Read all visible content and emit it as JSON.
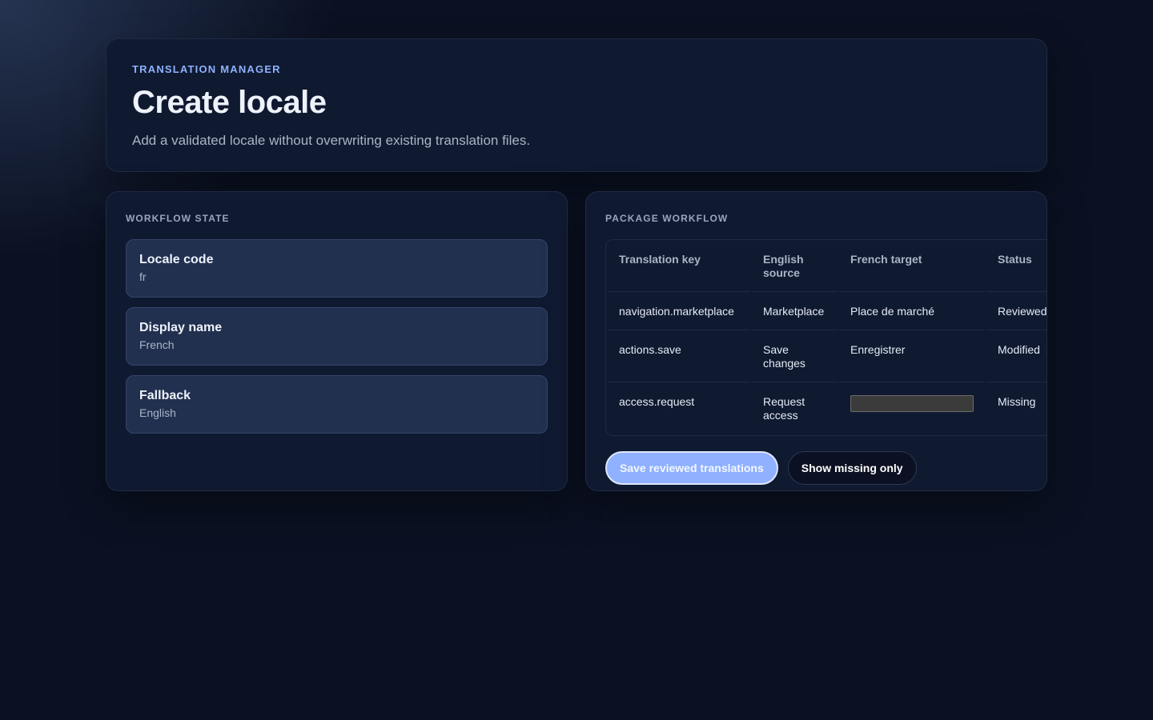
{
  "header": {
    "eyebrow": "Translation manager",
    "title": "Create locale",
    "subtitle": "Add a validated locale without overwriting existing translation files."
  },
  "workflow_state": {
    "title": "Workflow state",
    "items": [
      {
        "label": "Locale code",
        "value": "fr"
      },
      {
        "label": "Display name",
        "value": "French"
      },
      {
        "label": "Fallback",
        "value": "English"
      }
    ]
  },
  "package_workflow": {
    "title": "Package workflow",
    "columns": [
      "Translation key",
      "English source",
      "French target",
      "Status"
    ],
    "rows": [
      {
        "key": "navigation.marketplace",
        "source": "Marketplace",
        "target": "Place de marché",
        "status": "Reviewed"
      },
      {
        "key": "actions.save",
        "source": "Save changes",
        "target": "Enregistrer",
        "status": "Modified"
      },
      {
        "key": "access.request",
        "source": "Request access",
        "target": "",
        "status": "Missing"
      }
    ],
    "actions": {
      "save_label": "Save reviewed translations",
      "missing_label": "Show missing only"
    }
  },
  "colors": {
    "accent": "#8fb1ff",
    "background": "#0b1122",
    "card": "#0f1930",
    "state_item": "#22304f"
  }
}
